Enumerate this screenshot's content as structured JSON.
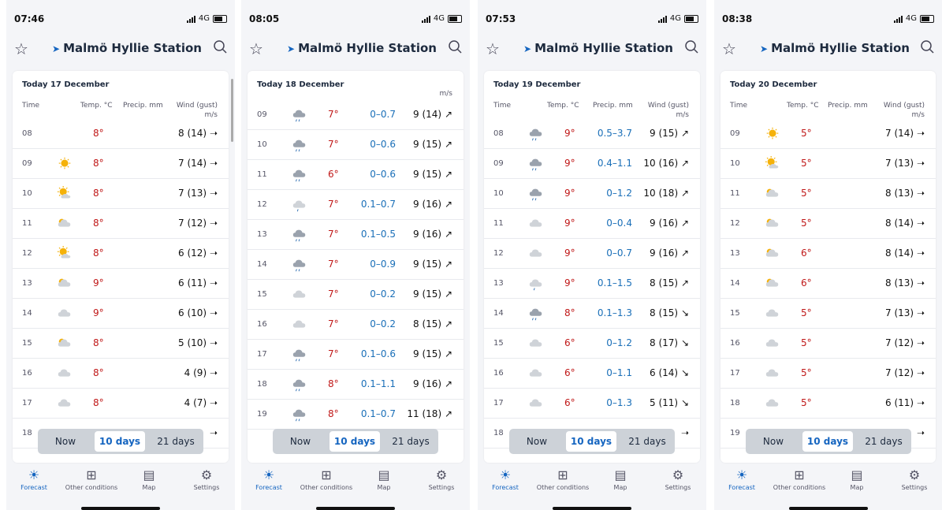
{
  "app": {
    "location": "Malmö Hyllie Station",
    "toggle": [
      "Now",
      "10 days",
      "21 days"
    ],
    "selected_toggle": "10 days",
    "tabs": [
      "Forecast",
      "Other conditions",
      "Map",
      "Settings"
    ],
    "active_tab": "Forecast",
    "network": "4G"
  },
  "headers": {
    "time": "Time",
    "temp": "Temp. °C",
    "precip": "Precip. mm",
    "wind": "Wind (gust)",
    "wind_unit": "m/s"
  },
  "screens": [
    {
      "clock": "07:46",
      "day": "Today 17 December",
      "rows": [
        {
          "h": "08",
          "icon": "moon",
          "t": "8°",
          "p": "",
          "w": "8 (14)",
          "d": "right"
        },
        {
          "h": "09",
          "icon": "sun",
          "t": "8°",
          "p": "",
          "w": "7 (14)",
          "d": "right"
        },
        {
          "h": "10",
          "icon": "sun-cloud",
          "t": "8°",
          "p": "",
          "w": "7 (13)",
          "d": "right"
        },
        {
          "h": "11",
          "icon": "cloud-sun",
          "t": "8°",
          "p": "",
          "w": "7 (12)",
          "d": "right"
        },
        {
          "h": "12",
          "icon": "sun-cloud",
          "t": "8°",
          "p": "",
          "w": "6 (12)",
          "d": "right"
        },
        {
          "h": "13",
          "icon": "cloud-sun",
          "t": "9°",
          "p": "",
          "w": "6 (11)",
          "d": "right"
        },
        {
          "h": "14",
          "icon": "cloud",
          "t": "9°",
          "p": "",
          "w": "6 (10)",
          "d": "right"
        },
        {
          "h": "15",
          "icon": "cloud-sun",
          "t": "8°",
          "p": "",
          "w": "5 (10)",
          "d": "right"
        },
        {
          "h": "16",
          "icon": "cloud-moon",
          "t": "8°",
          "p": "",
          "w": "4 (9)",
          "d": "right"
        },
        {
          "h": "17",
          "icon": "cloud",
          "t": "8°",
          "p": "",
          "w": "4 (7)",
          "d": "right"
        },
        {
          "h": "18",
          "icon": "none",
          "t": "",
          "p": "",
          "w": "",
          "d": "right"
        }
      ]
    },
    {
      "clock": "08:05",
      "day": "Today 18 December",
      "rows": [
        {
          "h": "09",
          "icon": "rain",
          "t": "7°",
          "p": "0–0.7",
          "w": "9 (14)",
          "d": "up"
        },
        {
          "h": "10",
          "icon": "rain",
          "t": "7°",
          "p": "0–0.6",
          "w": "9 (15)",
          "d": "up"
        },
        {
          "h": "11",
          "icon": "rain",
          "t": "6°",
          "p": "0–0.6",
          "w": "9 (15)",
          "d": "up"
        },
        {
          "h": "12",
          "icon": "rain-light",
          "t": "7°",
          "p": "0.1–0.7",
          "w": "9 (16)",
          "d": "up"
        },
        {
          "h": "13",
          "icon": "rain",
          "t": "7°",
          "p": "0.1–0.5",
          "w": "9 (16)",
          "d": "up"
        },
        {
          "h": "14",
          "icon": "rain",
          "t": "7°",
          "p": "0–0.9",
          "w": "9 (15)",
          "d": "up"
        },
        {
          "h": "15",
          "icon": "cloud",
          "t": "7°",
          "p": "0–0.2",
          "w": "9 (15)",
          "d": "up"
        },
        {
          "h": "16",
          "icon": "cloud",
          "t": "7°",
          "p": "0–0.2",
          "w": "8 (15)",
          "d": "up"
        },
        {
          "h": "17",
          "icon": "rain",
          "t": "7°",
          "p": "0.1–0.6",
          "w": "9 (15)",
          "d": "up"
        },
        {
          "h": "18",
          "icon": "rain",
          "t": "8°",
          "p": "0.1–1.1",
          "w": "9 (16)",
          "d": "up"
        },
        {
          "h": "19",
          "icon": "rain",
          "t": "8°",
          "p": "0.1–0.7",
          "w": "11 (18)",
          "d": "up"
        }
      ]
    },
    {
      "clock": "07:53",
      "day": "Today 19 December",
      "rows": [
        {
          "h": "08",
          "icon": "rain",
          "t": "9°",
          "p": "0.5–3.7",
          "w": "9 (15)",
          "d": "up"
        },
        {
          "h": "09",
          "icon": "rain",
          "t": "9°",
          "p": "0.4–1.1",
          "w": "10 (16)",
          "d": "up"
        },
        {
          "h": "10",
          "icon": "rain",
          "t": "9°",
          "p": "0–1.2",
          "w": "10 (18)",
          "d": "up"
        },
        {
          "h": "11",
          "icon": "cloud",
          "t": "9°",
          "p": "0–0.4",
          "w": "9 (16)",
          "d": "up"
        },
        {
          "h": "12",
          "icon": "cloud",
          "t": "9°",
          "p": "0–0.7",
          "w": "9 (16)",
          "d": "up"
        },
        {
          "h": "13",
          "icon": "rain-light",
          "t": "9°",
          "p": "0.1–1.5",
          "w": "8 (15)",
          "d": "up"
        },
        {
          "h": "14",
          "icon": "rain",
          "t": "8°",
          "p": "0.1–1.3",
          "w": "8 (15)",
          "d": "down"
        },
        {
          "h": "15",
          "icon": "cloud",
          "t": "6°",
          "p": "0–1.2",
          "w": "8 (17)",
          "d": "down"
        },
        {
          "h": "16",
          "icon": "cloud",
          "t": "6°",
          "p": "0–1.1",
          "w": "6 (14)",
          "d": "down"
        },
        {
          "h": "17",
          "icon": "cloud",
          "t": "6°",
          "p": "0–1.3",
          "w": "5 (11)",
          "d": "down"
        },
        {
          "h": "18",
          "icon": "none",
          "t": "",
          "p": "",
          "w": "",
          "d": "right"
        }
      ]
    },
    {
      "clock": "08:38",
      "day": "Today 20 December",
      "rows": [
        {
          "h": "09",
          "icon": "sun",
          "t": "5°",
          "p": "",
          "w": "7 (14)",
          "d": "right"
        },
        {
          "h": "10",
          "icon": "sun-cloud",
          "t": "5°",
          "p": "",
          "w": "7 (13)",
          "d": "right"
        },
        {
          "h": "11",
          "icon": "cloud-sun",
          "t": "5°",
          "p": "",
          "w": "8 (13)",
          "d": "right"
        },
        {
          "h": "12",
          "icon": "cloud-sun",
          "t": "5°",
          "p": "",
          "w": "8 (14)",
          "d": "right"
        },
        {
          "h": "13",
          "icon": "cloud-sun",
          "t": "6°",
          "p": "",
          "w": "8 (14)",
          "d": "right"
        },
        {
          "h": "14",
          "icon": "cloud-sun",
          "t": "6°",
          "p": "",
          "w": "8 (13)",
          "d": "right"
        },
        {
          "h": "15",
          "icon": "cloud",
          "t": "5°",
          "p": "",
          "w": "7 (13)",
          "d": "right"
        },
        {
          "h": "16",
          "icon": "cloud",
          "t": "5°",
          "p": "",
          "w": "7 (12)",
          "d": "right"
        },
        {
          "h": "17",
          "icon": "cloud-moon",
          "t": "5°",
          "p": "",
          "w": "7 (12)",
          "d": "right"
        },
        {
          "h": "18",
          "icon": "cloud-moon",
          "t": "5°",
          "p": "",
          "w": "6 (11)",
          "d": "right"
        },
        {
          "h": "19",
          "icon": "none",
          "t": "",
          "p": "",
          "w": "",
          "d": "right"
        }
      ]
    }
  ],
  "colors": {
    "accent": "#1565c0",
    "temp": "#c01818",
    "precip": "#1a6fb8"
  }
}
